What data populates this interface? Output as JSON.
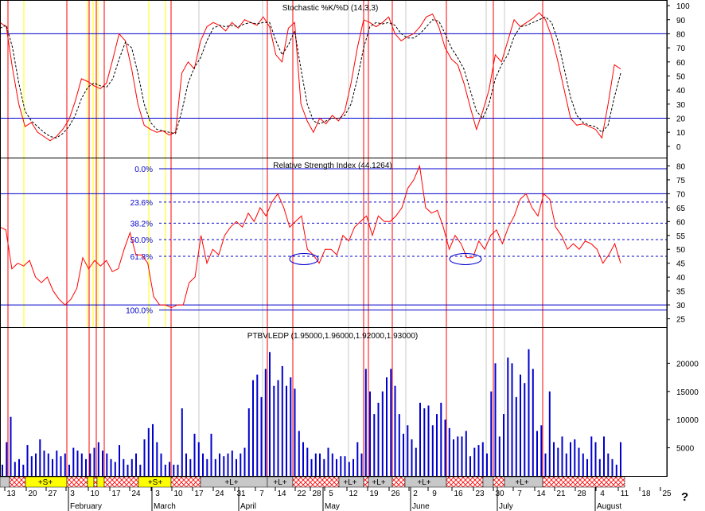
{
  "colors": {
    "red": "#ff0000",
    "blue": "#0000cc",
    "yellow": "#ffff00",
    "gray": "#c8c8c8",
    "black": "#000000"
  },
  "help_mark": "?",
  "chart_data": [
    {
      "type": "line",
      "title": "Stochastic %K/%D",
      "title_text": "Stochastic %K/%D (14,3,3)",
      "ylim": [
        -8,
        104
      ],
      "yticks": [
        "0",
        "10",
        "20",
        "30",
        "40",
        "50",
        "60",
        "70",
        "80",
        "90",
        "100"
      ],
      "ytick_values": [
        0,
        10,
        20,
        30,
        40,
        50,
        60,
        70,
        80,
        90,
        100
      ],
      "hlines": [
        80,
        20
      ],
      "series": [
        {
          "name": "%K",
          "values": [
            88,
            85,
            55,
            30,
            14,
            17,
            10,
            7,
            4,
            7,
            12,
            19,
            32,
            48,
            46,
            43,
            41,
            45,
            62,
            80,
            75,
            55,
            30,
            15,
            12,
            10,
            11,
            8,
            10,
            52,
            60,
            55,
            75,
            85,
            88,
            86,
            82,
            88,
            84,
            90,
            88,
            86,
            92,
            85,
            65,
            60,
            84,
            88,
            30,
            18,
            10,
            20,
            16,
            22,
            18,
            25,
            45,
            70,
            90,
            88,
            85,
            88,
            92,
            80,
            75,
            78,
            80,
            85,
            92,
            94,
            85,
            70,
            62,
            58,
            45,
            28,
            12,
            25,
            40,
            65,
            60,
            75,
            90,
            85,
            88,
            91,
            95,
            90,
            78,
            60,
            40,
            20,
            15,
            16,
            14,
            12,
            6,
            30,
            58,
            55
          ]
        },
        {
          "name": "%D",
          "values": [
            84,
            86,
            70,
            45,
            25,
            18,
            14,
            10,
            7,
            6,
            9,
            14,
            22,
            34,
            42,
            45,
            43,
            42,
            48,
            62,
            74,
            70,
            52,
            30,
            17,
            12,
            11,
            10,
            9,
            25,
            45,
            56,
            63,
            75,
            84,
            86,
            85,
            86,
            85,
            87,
            88,
            87,
            88,
            88,
            75,
            65,
            72,
            82,
            55,
            30,
            18,
            16,
            18,
            20,
            20,
            22,
            30,
            48,
            70,
            85,
            88,
            87,
            88,
            86,
            80,
            77,
            77,
            80,
            85,
            90,
            89,
            80,
            70,
            63,
            55,
            40,
            25,
            20,
            30,
            48,
            58,
            65,
            78,
            85,
            86,
            88,
            90,
            92,
            88,
            75,
            55,
            35,
            22,
            17,
            15,
            14,
            10,
            15,
            35,
            52
          ]
        }
      ]
    },
    {
      "type": "line",
      "title": "Relative Strength Index (44.1264)",
      "ylim": [
        22,
        83
      ],
      "yticks": [
        "25",
        "30",
        "35",
        "40",
        "45",
        "50",
        "55",
        "60",
        "65",
        "70",
        "75",
        "80"
      ],
      "ytick_values": [
        25,
        30,
        35,
        40,
        45,
        50,
        55,
        60,
        65,
        70,
        75,
        80
      ],
      "hlines": [
        70,
        30
      ],
      "fib_levels": [
        {
          "label": "0.0%",
          "value": 79
        },
        {
          "label": "23.6%",
          "value": 67
        },
        {
          "label": "38.2%",
          "value": 59.4
        },
        {
          "label": "50.0%",
          "value": 53.5
        },
        {
          "label": "61.8%",
          "value": 47.5
        },
        {
          "label": "100.0%",
          "value": 28.2
        }
      ],
      "series": [
        {
          "name": "RSI",
          "values": [
            58,
            57,
            43,
            45,
            44,
            46,
            40,
            38,
            40,
            35,
            32,
            30,
            32,
            36,
            47,
            43,
            46,
            44,
            46,
            42,
            43,
            50,
            56,
            48,
            48,
            45,
            33,
            30,
            30,
            29,
            30,
            30,
            38,
            40,
            55,
            45,
            50,
            48,
            55,
            58,
            60,
            58,
            63,
            60,
            65,
            62,
            67,
            70,
            65,
            58,
            60,
            62,
            50,
            48,
            45,
            50,
            50,
            48,
            55,
            53,
            58,
            60,
            62,
            55,
            62,
            60,
            60,
            62,
            65,
            72,
            75,
            80,
            65,
            63,
            64,
            58,
            50,
            55,
            52,
            47,
            47,
            53,
            50,
            55,
            57,
            52,
            58,
            62,
            68,
            70,
            65,
            62,
            70,
            68,
            58,
            55,
            50,
            52,
            50,
            53,
            52,
            50,
            45,
            48,
            52,
            45
          ]
        }
      ]
    },
    {
      "type": "bar",
      "title": "PTBVLEDP (1.95000,1.96000,1.92000,1.93000)",
      "ylim": [
        0,
        25000
      ],
      "yticks": [
        "5000",
        "10000",
        "15000",
        "20000"
      ],
      "ytick_values": [
        5000,
        10000,
        15000,
        20000
      ],
      "values": [
        2000,
        6000,
        10500,
        2500,
        3000,
        2000,
        5500,
        3500,
        4000,
        6500,
        4500,
        4000,
        3000,
        4500,
        3500,
        4000,
        2000,
        5000,
        4500,
        4000,
        3000,
        4000,
        5000,
        6000,
        4500,
        4000,
        3000,
        2500,
        5500,
        3000,
        2000,
        3000,
        4000,
        2000,
        6500,
        8500,
        9200,
        6000,
        4000,
        2000,
        2500,
        2000,
        2000,
        12000,
        4000,
        3000,
        7500,
        6000,
        4000,
        3000,
        7500,
        3000,
        4000,
        3500,
        4000,
        4500,
        3000,
        4000,
        5000,
        12000,
        17000,
        18000,
        14000,
        19000,
        22000,
        16000,
        17000,
        19500,
        16000,
        17500,
        15500,
        8000,
        6000,
        5000,
        3000,
        4000,
        4000,
        3000,
        5000,
        4000,
        3000,
        3500,
        3500,
        2500,
        3000,
        6000,
        4000,
        19000,
        15000,
        11000,
        13000,
        15000,
        17500,
        19000,
        16000,
        11000,
        7500,
        9000,
        6500,
        5000,
        13000,
        12000,
        12500,
        9000,
        11000,
        13000,
        10000,
        8500,
        6500,
        7000,
        7000,
        8000,
        3500,
        5000,
        5500,
        6000,
        4000,
        15000,
        20000,
        7000,
        11000,
        21000,
        20000,
        14000,
        18000,
        16500,
        22500,
        19000,
        8000,
        9000,
        4000,
        15000,
        6000,
        5000,
        7000,
        4000,
        6000,
        6500,
        5000,
        4000,
        3000,
        7000,
        6000,
        3000,
        7000,
        4000,
        3000,
        2000,
        6000
      ],
      "markers": [
        {
          "text": "+S+"
        },
        {
          "text": "+S+"
        },
        {
          "text": "+L+"
        },
        {
          "text": "+L+"
        },
        {
          "text": "+L+"
        },
        {
          "text": "+L+"
        },
        {
          "text": "+L+"
        },
        {
          "text": "+L+"
        }
      ],
      "xticks": [
        "13",
        "20",
        "27",
        "3",
        "10",
        "17",
        "24",
        "3",
        "10",
        "17",
        "24",
        "31",
        "7",
        "14",
        "22",
        "28",
        "5",
        "12",
        "19",
        "26",
        "2",
        "9",
        "16",
        "23",
        "30",
        "7",
        "14",
        "21",
        "28",
        "4",
        "11",
        "18",
        "25"
      ],
      "months": [
        "February",
        "March",
        "April",
        "May",
        "June",
        "July",
        "August"
      ]
    }
  ]
}
